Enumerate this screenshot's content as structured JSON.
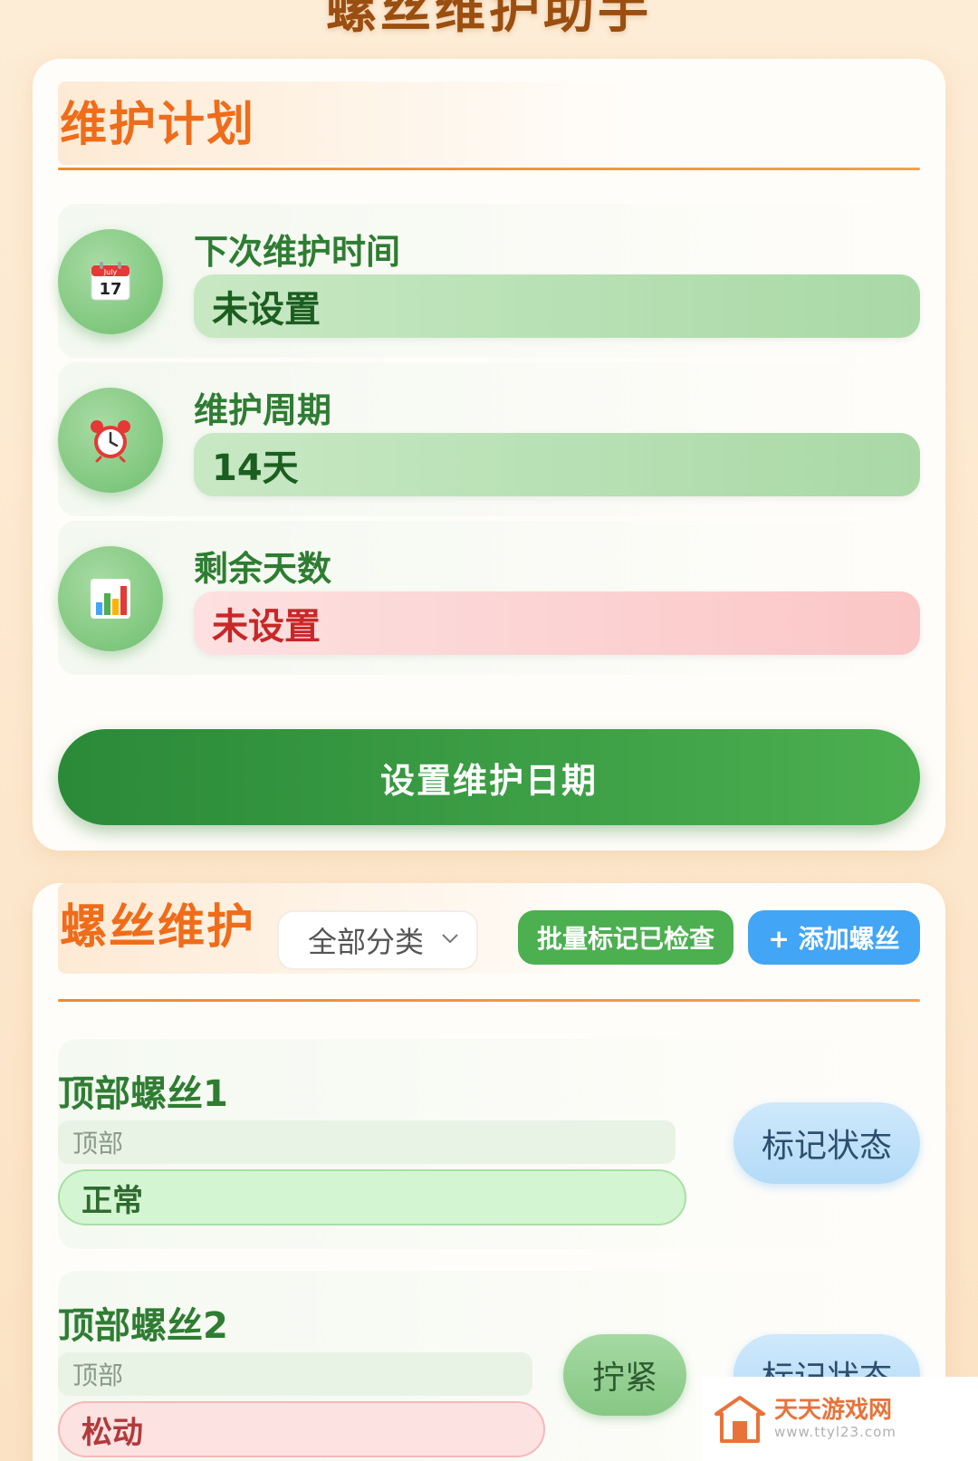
{
  "page": {
    "title": "螺丝维护助手"
  },
  "plan": {
    "title": "维护计划",
    "items": [
      {
        "label": "下次维护时间",
        "value": "未设置",
        "icon": "calendar-icon",
        "icon_text": "July 17"
      },
      {
        "label": "维护周期",
        "value": "14天",
        "icon": "alarm-clock-icon"
      },
      {
        "label": "剩余天数",
        "value": "未设置",
        "icon": "bar-chart-icon"
      }
    ],
    "set_button": "设置维护日期"
  },
  "screws": {
    "title": "螺丝维护",
    "filter": {
      "selected": "全部分类"
    },
    "batch_button": "批量标记已检查",
    "add_button": "+ 添加螺丝",
    "items": [
      {
        "name": "顶部螺丝1",
        "category": "顶部",
        "status": "正常",
        "mark_button": "标记状态"
      },
      {
        "name": "顶部螺丝2",
        "category": "顶部",
        "status": "松动",
        "tighten_button": "拧紧",
        "mark_button": "标记状态"
      }
    ]
  },
  "watermark": {
    "name": "天天游戏网",
    "url": "www.ttyl23.com"
  },
  "colors": {
    "accent_orange": "#ef6c1a",
    "green": "#2e7d32",
    "primary_green": "#4caf50",
    "blue": "#42a5f5",
    "red": "#c62828"
  }
}
